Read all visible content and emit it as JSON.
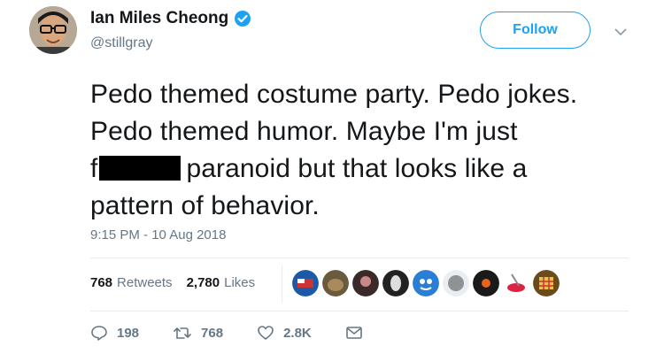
{
  "user": {
    "name": "Ian Miles Cheong",
    "handle": "@stillgray",
    "verified": true
  },
  "follow_label": "Follow",
  "tweet": {
    "line1": "Pedo themed costume party. Pedo jokes.",
    "line2": "Pedo themed humor. Maybe I'm just",
    "line3_start": "f",
    "line3_end": "paranoid but that looks like a",
    "line4": "pattern of behavior."
  },
  "timestamp": "9:15 PM - 10 Aug 2018",
  "stats": {
    "retweets_count": "768",
    "retweets_label": "Retweets",
    "likes_count": "2,780",
    "likes_label": "Likes"
  },
  "actions": {
    "replies": "198",
    "retweets": "768",
    "likes": "2.8K"
  },
  "colors": {
    "accent": "#1da1f2",
    "muted": "#657786",
    "text": "#14171a",
    "divider": "#e6ecf0"
  }
}
